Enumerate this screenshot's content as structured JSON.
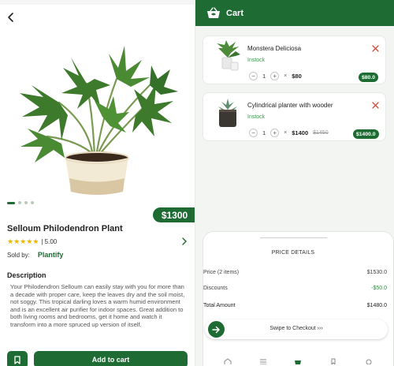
{
  "product": {
    "price": "$1300",
    "title": "Selloum Philodendron Plant",
    "rating_value": "| 5.00",
    "stars": "★★★★★",
    "sold_by_label": "Sold by:",
    "seller": "Plantify",
    "description_title": "Description",
    "description": "Your Philodendron Selloum can easily stay with you for more than a decade with proper care, keep the leaves dry and the soil moist, not soggy. This tropical darling loves a warm humid environment and is an excellent air purifier for indoor spaces. Great addition to both living rooms and bedrooms, get it home and watch it transform into a more spruced up version of itself.",
    "add_to_cart_label": "Add to cart",
    "carousel_dots": 4,
    "carousel_active": 0
  },
  "cart": {
    "title": "Cart",
    "items": [
      {
        "name": "Monstera Deliciosa",
        "stock": "Instock",
        "qty": "1",
        "times": "×",
        "unit_price": "$80",
        "old_price": "",
        "total": "$80.0",
        "thumb_icon": "potted-plant-icon"
      },
      {
        "name": "Cylindrical planter with wooder",
        "stock": "Instock",
        "qty": "1",
        "times": "×",
        "unit_price": "$1400",
        "old_price": "$1450",
        "total": "$1400.0",
        "thumb_icon": "succulent-pot-icon"
      }
    ],
    "price_details": {
      "title": "PRICE DETAILS",
      "price_label": "Price (2 items)",
      "price_value": "$1530.0",
      "discount_label": "Discounts",
      "discount_value": "-$50.0",
      "total_label": "Total Amount",
      "total_value": "$1480.0"
    },
    "checkout_label": "Swipe to Checkout ›››",
    "nav": [
      "home-icon",
      "list-icon",
      "cart-icon",
      "bookmark-icon",
      "settings-icon"
    ],
    "nav_active": 2
  },
  "colors": {
    "brand": "#1f6b34",
    "star": "#f3b400",
    "remove": "#e0483c",
    "instock": "#3a9a4d"
  }
}
